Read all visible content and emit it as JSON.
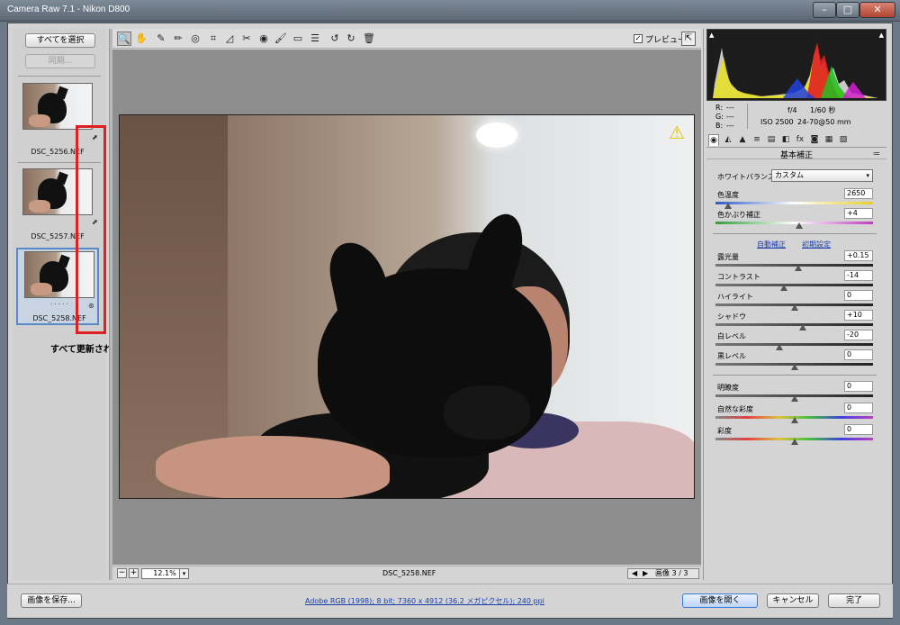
{
  "window": {
    "title": "Camera Raw 7.1  -  Nikon D800",
    "min_glyph": "–",
    "max_glyph": "□",
    "close_glyph": "✕"
  },
  "filmstrip": {
    "select_all": "すべてを選択",
    "sync": "同期...",
    "items": [
      {
        "name": "DSC_5256.NEF"
      },
      {
        "name": "DSC_5257.NEF"
      },
      {
        "name": "DSC_5258.NEF",
        "rating": "· · · · ·"
      }
    ],
    "annotation": "すべて更新された"
  },
  "toolbar": {
    "tools": [
      "zoom-tool",
      "hand-tool",
      "white-balance-tool",
      "color-sampler-tool",
      "target-adjust-tool",
      "crop-tool",
      "straighten-tool",
      "spot-removal-tool",
      "red-eye-tool",
      "adjustment-brush-tool",
      "graduated-filter-tool",
      "preferences",
      "rotate-left",
      "rotate-right",
      "trash"
    ],
    "glyphs": [
      "🔍",
      "✋",
      "✎",
      "✏",
      "◎",
      "⌗",
      "◿",
      "✂",
      "◉",
      "🖌",
      "▭",
      "☰",
      "↺",
      "↻",
      "🗑"
    ],
    "preview_label": "プレビュー",
    "preview_checked": "✓",
    "fullscreen": "⇱"
  },
  "preview": {
    "zoom_minus": "−",
    "zoom_plus": "+",
    "zoom": "12.1%",
    "zoom_dropdown": "▾",
    "filename": "DSC_5258.NEF",
    "nav_prev": "◀",
    "nav_next": "▶",
    "image_counter": "画像 3 / 3",
    "warning_icon": "⚠"
  },
  "histogram": {
    "shadow_clip": "▲",
    "highlight_clip": "▲",
    "r_label": "R:",
    "g_label": "G:",
    "b_label": "B:",
    "r_value": "---",
    "g_value": "---",
    "b_value": "---",
    "aperture": "f/4",
    "shutter": "1/60 秒",
    "iso": "ISO 2500",
    "lens": "24-70@50 mm"
  },
  "tabs": [
    "◉",
    "◭",
    "▲",
    "≡",
    "▤",
    "◧",
    "fx",
    "◙",
    "▦",
    "▧"
  ],
  "basic_panel": {
    "title": "基本補正",
    "menu_icon": "≔",
    "white_balance_label": "ホワイトバランス :",
    "white_balance_value": "カスタム",
    "dropdown_arrow": "▾",
    "temperature_label": "色温度",
    "temperature_value": "2650",
    "tint_label": "色かぶり補正",
    "tint_value": "+4",
    "auto_label": "自動補正",
    "default_label": "初期設定",
    "exposure_label": "露光量",
    "exposure_value": "+0.15",
    "contrast_label": "コントラスト",
    "contrast_value": "-14",
    "highlights_label": "ハイライト",
    "highlights_value": "0",
    "shadows_label": "シャドウ",
    "shadows_value": "+10",
    "whites_label": "白レベル",
    "whites_value": "-20",
    "blacks_label": "黒レベル",
    "blacks_value": "0",
    "clarity_label": "明瞭度",
    "clarity_value": "0",
    "vibrance_label": "自然な彩度",
    "vibrance_value": "0",
    "saturation_label": "彩度",
    "saturation_value": "0"
  },
  "bottom": {
    "save": "画像を保存...",
    "workflow": "Adobe RGB (1998); 8 bit; 7360 x 4912 (36.2 メガピクセル); 240 ppi",
    "open": "画像を開く",
    "cancel": "キャンセル",
    "done": "完了"
  }
}
